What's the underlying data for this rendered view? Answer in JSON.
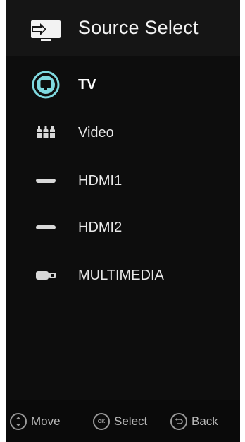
{
  "header": {
    "title": "Source Select",
    "icon": "source-input-icon"
  },
  "sources": [
    {
      "label": "TV",
      "icon": "tv-icon",
      "selected": true
    },
    {
      "label": "Video",
      "icon": "video-rca-icon",
      "selected": false
    },
    {
      "label": "HDMI1",
      "icon": "hdmi-icon",
      "selected": false
    },
    {
      "label": "HDMI2",
      "icon": "hdmi-icon",
      "selected": false
    },
    {
      "label": "MULTIMEDIA",
      "icon": "usb-icon",
      "selected": false
    }
  ],
  "footer": {
    "move": {
      "label": "Move",
      "icon": "dpad-icon"
    },
    "select": {
      "label": "Select",
      "icon": "ok-button-icon",
      "button_text": "OK"
    },
    "back": {
      "label": "Back",
      "icon": "back-arrow-icon"
    }
  },
  "colors": {
    "accent": "#7fd9e0",
    "background": "#0d0d0d",
    "text": "#e8e8e8"
  }
}
